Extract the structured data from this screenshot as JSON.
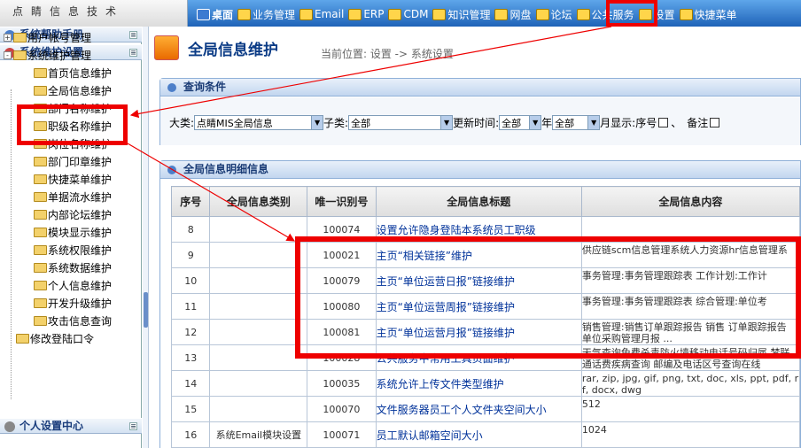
{
  "logo_text": "点睛信息技术",
  "topnav": [
    {
      "label": "桌面",
      "icon": "desktop-icon"
    },
    {
      "label": "业务管理",
      "icon": "business-icon"
    },
    {
      "label": "Email",
      "icon": "email-icon"
    },
    {
      "label": "ERP",
      "icon": "erp-icon"
    },
    {
      "label": "CDM",
      "icon": "cdm-icon"
    },
    {
      "label": "知识管理",
      "icon": "knowledge-icon"
    },
    {
      "label": "网盘",
      "icon": "netdisk-icon"
    },
    {
      "label": "论坛",
      "icon": "forum-icon"
    },
    {
      "label": "公共服务",
      "icon": "public-service-icon"
    },
    {
      "label": "设置",
      "icon": "settings-icon"
    },
    {
      "label": "快捷菜单",
      "icon": "quick-menu-icon"
    }
  ],
  "sidebar": {
    "help_title": "系统帮助手册",
    "maint_title": "系统维护设置",
    "personal_title": "个人设置中心",
    "tree": [
      "用户帐号管理",
      "系统维护管理",
      "首页信息维护",
      "全局信息维护",
      "部门名称维护",
      "职级名称维护",
      "岗位名称维护",
      "部门印章维护",
      "快捷菜单维护",
      "单据流水维护",
      "内部论坛维护",
      "模块显示维护",
      "系统权限维护",
      "系统数据维护",
      "个人信息维护",
      "开发升级维护",
      "攻击信息查询",
      "修改登陆口令"
    ]
  },
  "page": {
    "title": "全局信息维护",
    "breadcrumb": "当前位置: 设置 -> 系统设置"
  },
  "query": {
    "title": "查询条件",
    "category_label": "大类:",
    "category_value": "点睛MIS全局信息",
    "subcategory_label": "子类:",
    "subcategory_value": "全部",
    "update_time_label": "更新时间:",
    "time_value1": "全部",
    "year_label": "年",
    "time_value2": "全部",
    "month_label": "月",
    "display_label": "显示:",
    "seq_label": "序号",
    "sep": "、",
    "note_label": "备注"
  },
  "detail": {
    "title": "全局信息明细信息",
    "columns": [
      "序号",
      "全局信息类别",
      "唯一识别号",
      "全局信息标题",
      "全局信息内容"
    ],
    "rows": [
      {
        "seq": "8",
        "cat": "",
        "id": "100074",
        "title": "设置允许隐身登陆本系统员工职级",
        "content": ""
      },
      {
        "seq": "9",
        "cat": "",
        "id": "100021",
        "title": "主页“相关链接”维护",
        "content": "供应链scm信息管理系统人力资源hr信息管理系"
      },
      {
        "seq": "10",
        "cat": "",
        "id": "100079",
        "title": "主页“单位运营日报”链接维护",
        "content": "事务管理:事务管理跟踪表 工作计划:工作计"
      },
      {
        "seq": "11",
        "cat": "",
        "id": "100080",
        "title": "主页“单位运营周报”链接维护",
        "content": "事务管理:事务管理跟踪表 综合管理:单位考"
      },
      {
        "seq": "12",
        "cat": "",
        "id": "100081",
        "title": "主页“单位运营月报”链接维护",
        "content": "销售管理:销售订单跟踪报告 销售 订单跟踪报告 单位采购管理月报 ..."
      },
      {
        "seq": "13",
        "cat": "",
        "id": "100028",
        "title": "公共服务中常用工具页面维护",
        "content": "天气查询免费杀毒防火墙移动电话号码归属 梦联通话费疾病查询 邮编及电话区号查询在线"
      },
      {
        "seq": "14",
        "cat": "",
        "id": "100035",
        "title": "系统允许上传文件类型维护",
        "content": "rar, zip, jpg, gif, png, txt, doc, xls, ppt, pdf, r f, docx, dwg"
      },
      {
        "seq": "15",
        "cat": "",
        "id": "100070",
        "title": "文件服务器员工个人文件夹空间大小",
        "content": "512"
      },
      {
        "seq": "16",
        "cat": "系统Email模块设置",
        "id": "100071",
        "title": "员工默认邮箱空间大小",
        "content": "1024"
      }
    ]
  }
}
